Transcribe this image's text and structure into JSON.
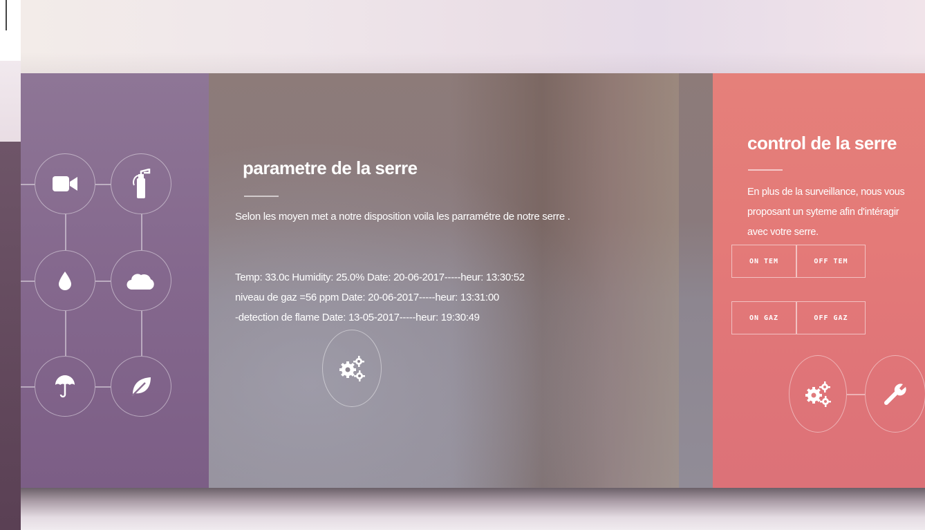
{
  "params": {
    "title": "parametre de la serre",
    "description": "Selon les moyen met a notre disposition voila les parramétre de notre serre .",
    "readings": [
      "Temp: 33.0c Humidity: 25.0% Date: 20-06-2017-----heur: 13:30:52",
      "niveau de gaz =56 ppm Date: 20-06-2017-----heur: 13:31:00",
      "-detection de flame Date: 13-05-2017-----heur: 19:30:49"
    ]
  },
  "control": {
    "title": "control de la serre",
    "description": "En plus de la surveillance, nous vous proposant un syteme afin d'intéragir avec votre serre.",
    "buttons": {
      "on_tem": "ON TEM",
      "off_tem": "OFF TEM",
      "on_gaz": "ON GAZ",
      "off_gaz": "OFF GAZ"
    }
  },
  "icons": {
    "left_grid": [
      "video-camera-icon",
      "fire-extinguisher-icon",
      "water-drop-icon",
      "cloud-icon",
      "umbrella-icon",
      "leaf-icon"
    ],
    "middle": "gears-icon",
    "right": [
      "gears-icon",
      "wrench-icon"
    ]
  }
}
